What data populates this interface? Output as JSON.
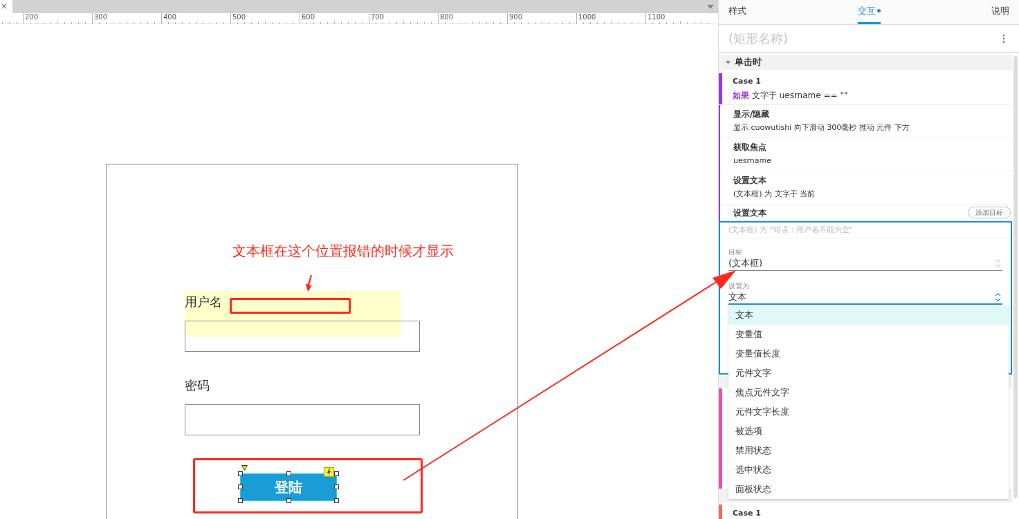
{
  "document_tabs": {
    "close": "×"
  },
  "ruler": {
    "labels": [
      "200",
      "300",
      "400",
      "500",
      "600",
      "700",
      "800",
      "900",
      "1000",
      "1100"
    ]
  },
  "canvas": {
    "annotation": "文本框在这个位置报错的时候才显示",
    "fields": [
      {
        "label": "用户名",
        "highlighted": true
      },
      {
        "label": "密码",
        "highlighted": false
      }
    ],
    "login_button": {
      "label": "登陆",
      "selected": true
    }
  },
  "panel": {
    "tabs": [
      {
        "label": "样式",
        "selected": false,
        "dot": false
      },
      {
        "label": "交互",
        "selected": true,
        "dot": true
      },
      {
        "label": "说明",
        "selected": false,
        "dot": false
      }
    ],
    "name_placeholder": "(矩形名称)",
    "event": {
      "title": "单击时",
      "expanded": true
    },
    "cases": [
      {
        "title": "Case 1",
        "condition_keyword": "如果",
        "condition": "文字于 uesrname == \"\"",
        "color": "#a033f0",
        "actions": [
          {
            "title": "显示/隐藏",
            "detail": "显示 cuowutishi 向下滑动 300毫秒 推动 元件 下方"
          },
          {
            "title": "获取焦点",
            "detail": "uesrname"
          },
          {
            "title": "设置文本",
            "detail": "(文本框) 为 文字于 当前"
          }
        ],
        "editing": {
          "title": "设置文本",
          "add_target": "添加目标",
          "summary_placeholder": "(文本框) 为 \"错误：用户名不能为空\"",
          "target": {
            "label": "目标",
            "value": "(文本框)"
          },
          "set_as": {
            "label": "设置为",
            "value": "文本",
            "options": [
              {
                "label": "文本",
                "selected": true
              },
              {
                "label": "变量值",
                "selected": false
              },
              {
                "label": "变量值长度",
                "selected": false
              },
              {
                "label": "元件文字",
                "selected": false
              },
              {
                "label": "焦点元件文字",
                "selected": false
              },
              {
                "label": "元件文字长度",
                "selected": false
              },
              {
                "label": "被选项",
                "selected": false
              },
              {
                "label": "禁用状态",
                "selected": false
              },
              {
                "label": "选中状态",
                "selected": false
              },
              {
                "label": "面板状态",
                "selected": false
              }
            ]
          }
        }
      },
      {
        "title": "Case 1",
        "color": "#f56b5a"
      }
    ]
  }
}
